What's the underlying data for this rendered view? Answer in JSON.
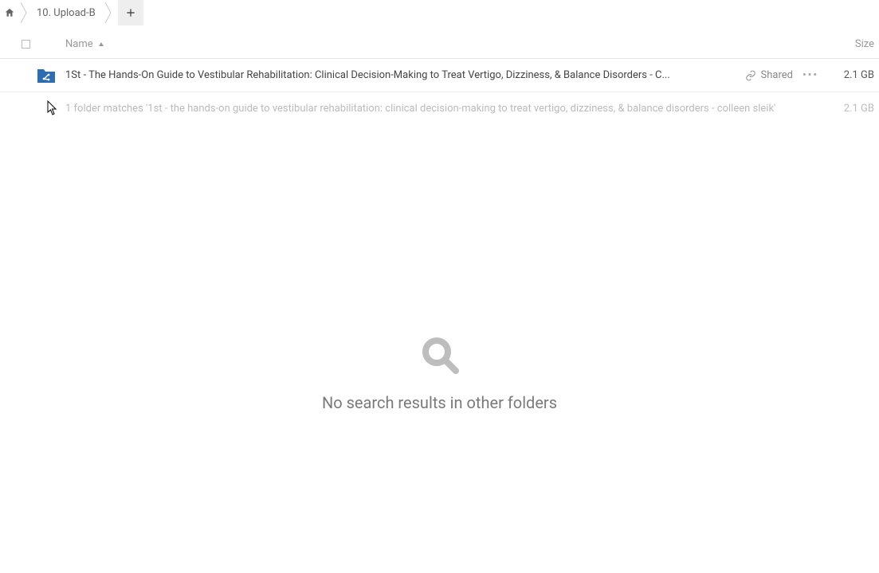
{
  "breadcrumb": {
    "current_label": "10. Upload-B"
  },
  "columns": {
    "name_label": "Name",
    "size_label": "Size"
  },
  "rows": [
    {
      "name": "1St - The Hands-On Guide to Vestibular Rehabilitation: Clinical Decision-Making to Treat Vertigo, Dizziness, & Balance Disorders - C...",
      "shared_label": "Shared",
      "size": "2.1 GB"
    }
  ],
  "summary": {
    "text": "1 folder matches '1st - the hands-on guide to vestibular rehabilitation: clinical decision-making to treat vertigo, dizziness, & balance disorders - colleen sleik'",
    "size": "2.1 GB"
  },
  "empty_state": {
    "message": "No search results in other folders"
  },
  "colors": {
    "folder_blue": "#2d6db3"
  }
}
